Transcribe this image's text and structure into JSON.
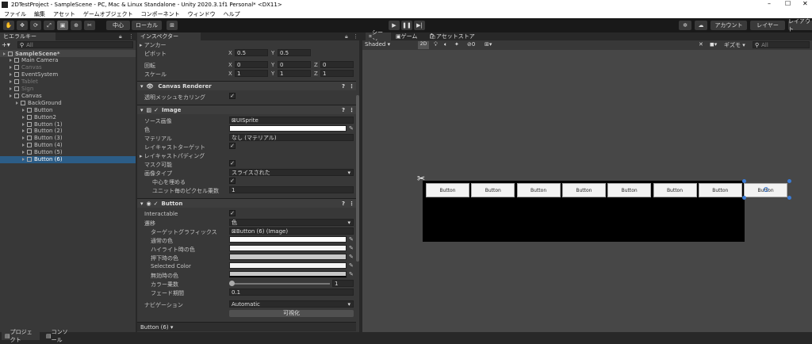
{
  "window": {
    "title": "2DTestProject - SampleScene - PC, Mac & Linux Standalone - Unity 2020.3.1f1 Personal* <DX11>"
  },
  "menu": [
    "ファイル",
    "編集",
    "アセット",
    "ゲームオブジェクト",
    "コンポーネント",
    "ウィンドウ",
    "ヘルプ"
  ],
  "toolbar": {
    "pivot": "中心",
    "space": "ローカル",
    "account": "アカウント",
    "layers": "レイヤー",
    "layout": "レイアウト"
  },
  "hierarchy": {
    "tab": "ヒエラルキー",
    "search": "All",
    "items": [
      {
        "label": "SampleScene*",
        "depth": 0,
        "kind": "scene"
      },
      {
        "label": "Main Camera",
        "depth": 1,
        "kind": "obj"
      },
      {
        "label": "Canvas",
        "depth": 1,
        "kind": "dim"
      },
      {
        "label": "EventSystem",
        "depth": 1,
        "kind": "obj"
      },
      {
        "label": "Tablet",
        "depth": 1,
        "kind": "dim"
      },
      {
        "label": "Sign",
        "depth": 1,
        "kind": "dim"
      },
      {
        "label": "Canvas",
        "depth": 1,
        "kind": "obj"
      },
      {
        "label": "BackGround",
        "depth": 2,
        "kind": "obj"
      },
      {
        "label": "Button",
        "depth": 3,
        "kind": "obj"
      },
      {
        "label": "Button2",
        "depth": 3,
        "kind": "obj"
      },
      {
        "label": "Button (1)",
        "depth": 3,
        "kind": "obj"
      },
      {
        "label": "Button (2)",
        "depth": 3,
        "kind": "obj"
      },
      {
        "label": "Button (3)",
        "depth": 3,
        "kind": "obj"
      },
      {
        "label": "Button (4)",
        "depth": 3,
        "kind": "obj"
      },
      {
        "label": "Button (5)",
        "depth": 3,
        "kind": "obj"
      },
      {
        "label": "Button (6)",
        "depth": 3,
        "kind": "selected"
      }
    ]
  },
  "inspector": {
    "tab": "インスペクター",
    "anchor_label": "アンカー",
    "pivot": {
      "label": "ピボット",
      "x": "0.5",
      "y": "0.5"
    },
    "rotation": {
      "label": "回転",
      "x": "0",
      "y": "0",
      "z": "0"
    },
    "scale": {
      "label": "スケール",
      "x": "1",
      "y": "1",
      "z": "1"
    },
    "canvas_renderer": {
      "title": "Canvas Renderer",
      "cull_label": "透明メッシュをカリング"
    },
    "image": {
      "title": "Image",
      "source_label": "ソース画像",
      "source_value": "UISprite",
      "color_label": "色",
      "material_label": "マテリアル",
      "material_value": "なし (マテリアル)",
      "raycast_label": "レイキャストターゲット",
      "padding_label": "レイキャストパディング",
      "maskable_label": "マスク可能",
      "type_label": "画像タイプ",
      "type_value": "スライスされた",
      "fill_center_label": "中心を埋める",
      "ppu_label": "ユニット毎のピクセル乗数",
      "ppu_value": "1"
    },
    "button": {
      "title": "Button",
      "interactable_label": "Interactable",
      "transition_label": "遷移",
      "transition_value": "色",
      "target_label": "ターゲットグラフィックス",
      "target_value": "Button (6) (Image)",
      "normal_label": "通常の色",
      "highlight_label": "ハイライト時の色",
      "pressed_label": "押下時の色",
      "selected_label": "Selected Color",
      "disabled_label": "無効時の色",
      "multiplier_label": "カラー乗数",
      "multiplier_value": "1",
      "fade_label": "フェード期間",
      "fade_value": "0.1",
      "nav_label": "ナビゲーション",
      "nav_value": "Automatic",
      "visualize_label": "可視化"
    },
    "footer": "Button (6)"
  },
  "scene": {
    "tabs": [
      "シーン",
      "ゲーム",
      "アセットストア"
    ],
    "shading": "Shaded",
    "mode_2d": "2D",
    "hidden_count": "0",
    "gizmos": "ギズモ",
    "search": "All",
    "buttons": [
      "Button",
      "Button",
      "Button",
      "Button",
      "Button",
      "Button",
      "Button",
      "Button"
    ]
  },
  "bottom_tabs": [
    "プロジェクト",
    "コンソール"
  ],
  "colors": {
    "selection": "#2c5d87",
    "accent": "#3b7bd4",
    "canvas": "#000000"
  }
}
